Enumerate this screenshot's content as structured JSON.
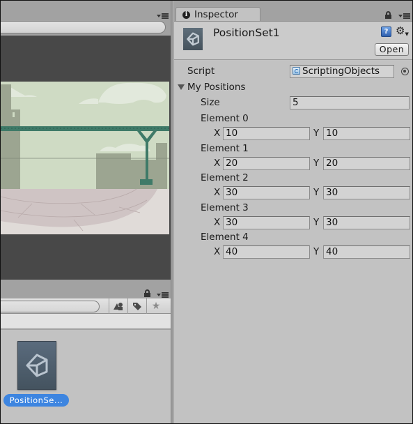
{
  "scene_panel": {
    "menu_icon": "panel-options-icon",
    "search_placeholder": ""
  },
  "project_panel": {
    "lock_icon": "lock-icon",
    "menu_icon": "panel-options-icon",
    "search_placeholder": "",
    "toolbar_buttons": [
      {
        "name": "filter-by-type-button",
        "icon": "shapes-icon",
        "glyph": "▲●"
      },
      {
        "name": "filter-by-label-button",
        "icon": "tag-icon",
        "glyph": "🏷"
      },
      {
        "name": "favorites-button",
        "icon": "star-icon",
        "glyph": "★"
      }
    ],
    "asset": {
      "label": "PositionSe...",
      "selected": true,
      "icon": "unity-asset-icon"
    }
  },
  "inspector": {
    "tab_label": "Inspector",
    "tab_icon": "info-icon",
    "info_glyph": "i",
    "lock_icon": "lock-icon",
    "menu_icon": "panel-options-icon",
    "object_title": "PositionSet1",
    "help_glyph": "?",
    "gear_glyph": "⚙",
    "open_button": "Open",
    "script": {
      "label": "Script",
      "value": "ScriptingObjects"
    },
    "foldout": {
      "label": "My Positions",
      "expanded": true
    },
    "size": {
      "label": "Size",
      "value": "5"
    },
    "x_label": "X",
    "y_label": "Y",
    "elements": [
      {
        "label": "Element 0",
        "x": "10",
        "y": "10"
      },
      {
        "label": "Element 1",
        "x": "20",
        "y": "20"
      },
      {
        "label": "Element 2",
        "x": "30",
        "y": "30"
      },
      {
        "label": "Element 3",
        "x": "30",
        "y": "30"
      },
      {
        "label": "Element 4",
        "x": "40",
        "y": "40"
      }
    ]
  },
  "colors": {
    "selection_blue": "#3d85e0",
    "inspector_bg": "#c2c2c2",
    "scene_bg": "#484848",
    "bridge_green": "#3f7a68"
  }
}
